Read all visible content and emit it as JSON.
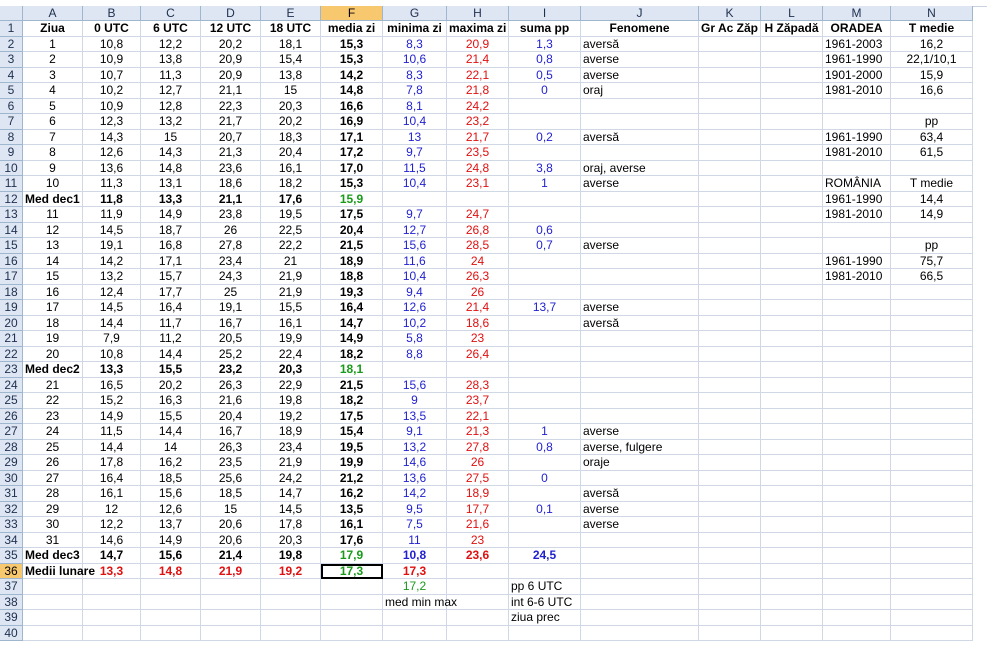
{
  "columns": [
    "A",
    "B",
    "C",
    "D",
    "E",
    "F",
    "G",
    "H",
    "I",
    "J",
    "K",
    "L",
    "M",
    "N"
  ],
  "rowNumbers": [
    "1",
    "2",
    "3",
    "4",
    "5",
    "6",
    "7",
    "8",
    "9",
    "10",
    "11",
    "12",
    "13",
    "14",
    "15",
    "16",
    "17",
    "18",
    "19",
    "20",
    "21",
    "22",
    "23",
    "24",
    "25",
    "26",
    "27",
    "28",
    "29",
    "30",
    "31",
    "32",
    "33",
    "34",
    "35",
    "36",
    "37",
    "38",
    "39",
    "40"
  ],
  "selection": {
    "column": "F",
    "row": "36"
  },
  "colors": {
    "blue": "#1f1fd0",
    "red": "#e01010",
    "green": "#1a9a1a",
    "header": "#dde6f2",
    "selectedHeader": "#f8c86e"
  },
  "rows": [
    {
      "A": "Ziua",
      "B": "0 UTC",
      "C": "6 UTC",
      "D": "12 UTC",
      "E": "18 UTC",
      "F": "media zi",
      "G": "minima zi",
      "H": "maxima zi",
      "I": "suma pp",
      "J": "Fenomene",
      "K": "Gr Ac Zăp",
      "L": "H Zăpadă",
      "M": "ORADEA",
      "N": "T medie"
    },
    {
      "A": "1",
      "B": "10,8",
      "C": "12,2",
      "D": "20,2",
      "E": "18,1",
      "F": "15,3",
      "G": "8,3",
      "H": "20,9",
      "I": "1,3",
      "J": "aversă",
      "M": "1961-2003",
      "N": "16,2"
    },
    {
      "A": "2",
      "B": "10,9",
      "C": "13,8",
      "D": "20,9",
      "E": "15,4",
      "F": "15,3",
      "G": "10,6",
      "H": "21,4",
      "I": "0,8",
      "J": "averse",
      "M": "1961-1990",
      "N": "22,1/10,1"
    },
    {
      "A": "3",
      "B": "10,7",
      "C": "11,3",
      "D": "20,9",
      "E": "13,8",
      "F": "14,2",
      "G": "8,3",
      "H": "22,1",
      "I": "0,5",
      "J": "averse",
      "M": "1901-2000",
      "N": "15,9"
    },
    {
      "A": "4",
      "B": "10,2",
      "C": "12,7",
      "D": "21,1",
      "E": "15",
      "F": "14,8",
      "G": "7,8",
      "H": "21,8",
      "I": "0",
      "J": "oraj",
      "M": "1981-2010",
      "N": "16,6"
    },
    {
      "A": "5",
      "B": "10,9",
      "C": "12,8",
      "D": "22,3",
      "E": "20,3",
      "F": "16,6",
      "G": "8,1",
      "H": "24,2"
    },
    {
      "A": "6",
      "B": "12,3",
      "C": "13,2",
      "D": "21,7",
      "E": "20,2",
      "F": "16,9",
      "G": "10,4",
      "H": "23,2",
      "N": "pp"
    },
    {
      "A": "7",
      "B": "14,3",
      "C": "15",
      "D": "20,7",
      "E": "18,3",
      "F": "17,1",
      "G": "13",
      "H": "21,7",
      "I": "0,2",
      "J": "aversă",
      "M": "1961-1990",
      "N": "63,4"
    },
    {
      "A": "8",
      "B": "12,6",
      "C": "14,3",
      "D": "21,3",
      "E": "20,4",
      "F": "17,2",
      "G": "9,7",
      "H": "23,5",
      "M": "1981-2010",
      "N": "61,5"
    },
    {
      "A": "9",
      "B": "13,6",
      "C": "14,8",
      "D": "23,6",
      "E": "16,1",
      "F": "17,0",
      "G": "11,5",
      "H": "24,8",
      "I": "3,8",
      "J": "oraj, averse"
    },
    {
      "A": "10",
      "B": "11,3",
      "C": "13,1",
      "D": "18,6",
      "E": "18,2",
      "F": "15,3",
      "G": "10,4",
      "H": "23,1",
      "I": "1",
      "J": "averse",
      "M": "ROMÂNIA",
      "N": "T medie"
    },
    {
      "A": "Med dec1",
      "B": "11,8",
      "C": "13,3",
      "D": "21,1",
      "E": "17,6",
      "F": "15,9",
      "M": "1961-1990",
      "N": "14,4"
    },
    {
      "A": "11",
      "B": "11,9",
      "C": "14,9",
      "D": "23,8",
      "E": "19,5",
      "F": "17,5",
      "G": "9,7",
      "H": "24,7",
      "M": "1981-2010",
      "N": "14,9"
    },
    {
      "A": "12",
      "B": "14,5",
      "C": "18,7",
      "D": "26",
      "E": "22,5",
      "F": "20,4",
      "G": "12,7",
      "H": "26,8",
      "I": "0,6"
    },
    {
      "A": "13",
      "B": "19,1",
      "C": "16,8",
      "D": "27,8",
      "E": "22,2",
      "F": "21,5",
      "G": "15,6",
      "H": "28,5",
      "I": "0,7",
      "J": "averse",
      "N": "pp"
    },
    {
      "A": "14",
      "B": "14,2",
      "C": "17,1",
      "D": "23,4",
      "E": "21",
      "F": "18,9",
      "G": "11,6",
      "H": "24",
      "M": "1961-1990",
      "N": "75,7"
    },
    {
      "A": "15",
      "B": "13,2",
      "C": "15,7",
      "D": "24,3",
      "E": "21,9",
      "F": "18,8",
      "G": "10,4",
      "H": "26,3",
      "M": "1981-2010",
      "N": "66,5"
    },
    {
      "A": "16",
      "B": "12,4",
      "C": "17,7",
      "D": "25",
      "E": "21,9",
      "F": "19,3",
      "G": "9,4",
      "H": "26"
    },
    {
      "A": "17",
      "B": "14,5",
      "C": "16,4",
      "D": "19,1",
      "E": "15,5",
      "F": "16,4",
      "G": "12,6",
      "H": "21,4",
      "I": "13,7",
      "J": "averse"
    },
    {
      "A": "18",
      "B": "14,4",
      "C": "11,7",
      "D": "16,7",
      "E": "16,1",
      "F": "14,7",
      "G": "10,2",
      "H": "18,6",
      "J": "aversă"
    },
    {
      "A": "19",
      "B": "7,9",
      "C": "11,2",
      "D": "20,5",
      "E": "19,9",
      "F": "14,9",
      "G": "5,8",
      "H": "23"
    },
    {
      "A": "20",
      "B": "10,8",
      "C": "14,4",
      "D": "25,2",
      "E": "22,4",
      "F": "18,2",
      "G": "8,8",
      "H": "26,4"
    },
    {
      "A": "Med dec2",
      "B": "13,3",
      "C": "15,5",
      "D": "23,2",
      "E": "20,3",
      "F": "18,1"
    },
    {
      "A": "21",
      "B": "16,5",
      "C": "20,2",
      "D": "26,3",
      "E": "22,9",
      "F": "21,5",
      "G": "15,6",
      "H": "28,3"
    },
    {
      "A": "22",
      "B": "15,2",
      "C": "16,3",
      "D": "21,6",
      "E": "19,8",
      "F": "18,2",
      "G": "9",
      "H": "23,7"
    },
    {
      "A": "23",
      "B": "14,9",
      "C": "15,5",
      "D": "20,4",
      "E": "19,2",
      "F": "17,5",
      "G": "13,5",
      "H": "22,1"
    },
    {
      "A": "24",
      "B": "11,5",
      "C": "14,4",
      "D": "16,7",
      "E": "18,9",
      "F": "15,4",
      "G": "9,1",
      "H": "21,3",
      "I": "1",
      "J": "averse"
    },
    {
      "A": "25",
      "B": "14,4",
      "C": "14",
      "D": "26,3",
      "E": "23,4",
      "F": "19,5",
      "G": "13,2",
      "H": "27,8",
      "I": "0,8",
      "J": "averse, fulgere"
    },
    {
      "A": "26",
      "B": "17,8",
      "C": "16,2",
      "D": "23,5",
      "E": "21,9",
      "F": "19,9",
      "G": "14,6",
      "H": "26",
      "J": "oraje"
    },
    {
      "A": "27",
      "B": "16,4",
      "C": "18,5",
      "D": "25,6",
      "E": "24,2",
      "F": "21,2",
      "G": "13,6",
      "H": "27,5",
      "I": "0"
    },
    {
      "A": "28",
      "B": "16,1",
      "C": "15,6",
      "D": "18,5",
      "E": "14,7",
      "F": "16,2",
      "G": "14,2",
      "H": "18,9",
      "J": "aversă"
    },
    {
      "A": "29",
      "B": "12",
      "C": "12,6",
      "D": "15",
      "E": "14,5",
      "F": "13,5",
      "G": "9,5",
      "H": "17,7",
      "I": "0,1",
      "J": "averse"
    },
    {
      "A": "30",
      "B": "12,2",
      "C": "13,7",
      "D": "20,6",
      "E": "17,8",
      "F": "16,1",
      "G": "7,5",
      "H": "21,6",
      "J": "averse"
    },
    {
      "A": "31",
      "B": "14,6",
      "C": "14,9",
      "D": "20,6",
      "E": "20,3",
      "F": "17,6",
      "G": "11",
      "H": "23"
    },
    {
      "A": "Med dec3",
      "B": "14,7",
      "C": "15,6",
      "D": "21,4",
      "E": "19,8",
      "F": "17,9",
      "G": "10,8",
      "H": "23,6",
      "I": "24,5"
    },
    {
      "A": "Medii lunare",
      "B": "13,3",
      "C": "14,8",
      "D": "21,9",
      "E": "19,2",
      "F": "17,3",
      "G": "17,3"
    },
    {
      "G": "17,2",
      "I": "pp 6 UTC"
    },
    {
      "G": "med min max",
      "I": "int 6-6 UTC"
    },
    {
      "I": "ziua prec"
    },
    {}
  ]
}
